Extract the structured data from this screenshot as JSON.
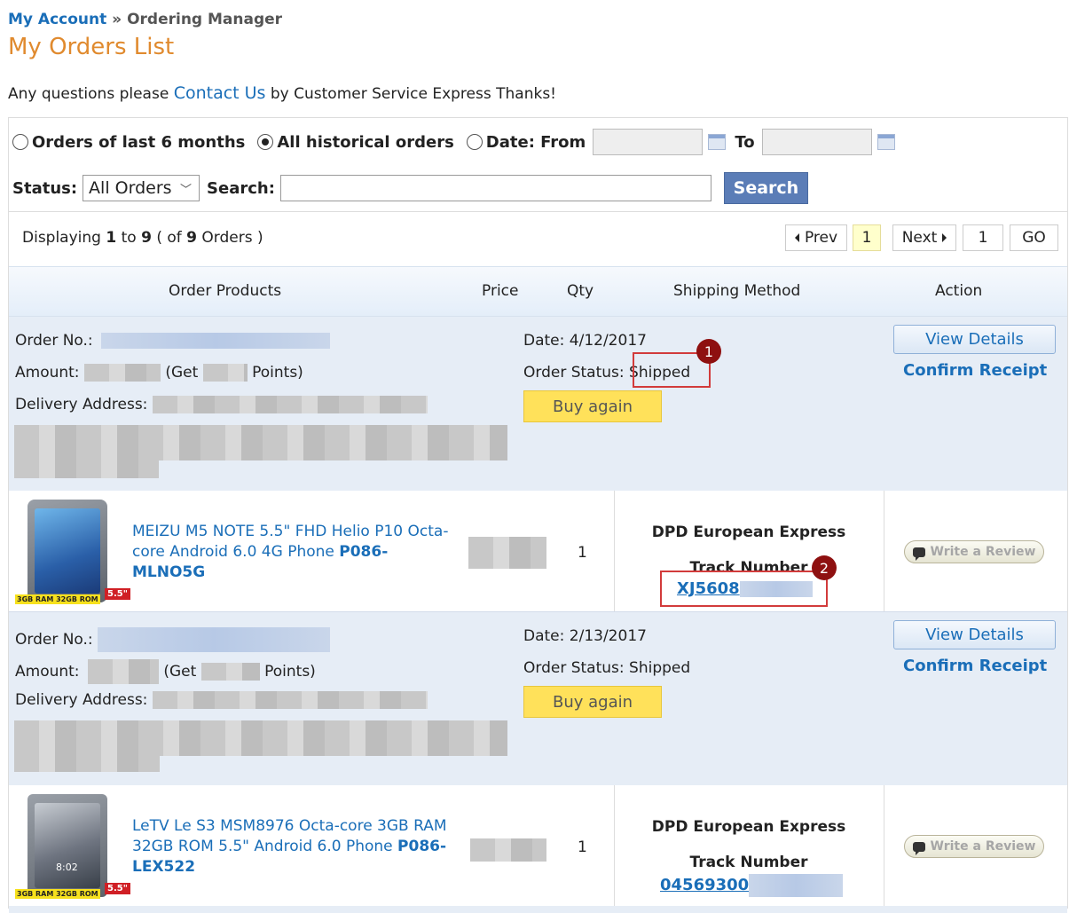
{
  "breadcrumb": {
    "home": "My Account",
    "sep": "»",
    "current": "Ordering Manager"
  },
  "page": {
    "title": "My Orders List"
  },
  "notice": {
    "before": "Any questions please",
    "link": "Contact Us",
    "after": "by Customer Service Express Thanks!"
  },
  "filters": {
    "range_6months": "Orders of last 6 months",
    "range_all": "All historical orders",
    "date_from": "Date: From",
    "date_to": "To",
    "status_label": "Status:",
    "status_value": "All Orders",
    "search_label": "Search:",
    "search_button": "Search",
    "selected_range": "all"
  },
  "pagination": {
    "prefix": "Displaying",
    "start": "1",
    "to": "to",
    "end": "9",
    "of_open": "( of",
    "total": "9",
    "of_close": "Orders )",
    "prev": "Prev",
    "current": "1",
    "next": "Next",
    "jump_value": "1",
    "go": "GO"
  },
  "table": {
    "headers": [
      "Order Products",
      "Price",
      "Qty",
      "Shipping Method",
      "Action"
    ]
  },
  "labels": {
    "order_no": "Order No.:",
    "amount": "Amount:",
    "get": "(Get",
    "points": "Points)",
    "delivery": "Delivery Address:",
    "date_prefix": "Date:",
    "status_prefix": "Order Status:",
    "buy_again": "Buy again",
    "view_details": "View Details",
    "confirm_receipt": "Confirm Receipt",
    "track_number": "Track Number",
    "write_review": "Write a Review"
  },
  "orders": [
    {
      "date": "4/12/2017",
      "status": "Shipped",
      "product": {
        "name": "MEIZU M5 NOTE 5.5\" FHD Helio P10 Octa-core Android 6.0 4G Phone",
        "sku": "P086-MLNO5G",
        "qty": "1",
        "ram_tag": "3GB RAM 32GB ROM",
        "size_tag": "5.5\""
      },
      "shipping": "DPD European Express",
      "track_number": "XJ5608"
    },
    {
      "date": "2/13/2017",
      "status": "Shipped",
      "product": {
        "name": "LeTV Le S3 MSM8976 Octa-core 3GB RAM 32GB ROM 5.5\" Android 6.0 Phone",
        "sku": "P086-LEX522",
        "qty": "1",
        "ram_tag": "3GB RAM 32GB ROM",
        "size_tag": "5.5\"",
        "screen_time": "8:02"
      },
      "shipping": "DPD European Express",
      "track_number": "04569300"
    }
  ],
  "annotations": {
    "one": "1",
    "two": "2"
  },
  "colors": {
    "link": "#1a6eb8",
    "title": "#e08a2e",
    "search_button": "#5b7db7",
    "buy_again": "#ffe15a",
    "order_block": "#e6edf6",
    "highlight": "#d23b3b",
    "badge": "#8e1010"
  }
}
